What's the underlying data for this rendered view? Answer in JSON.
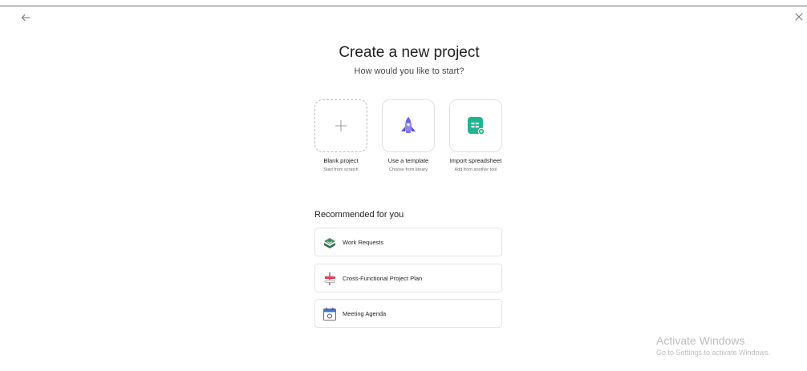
{
  "header": {
    "title": "Create a new project",
    "subtitle": "How would you like to start?"
  },
  "options": [
    {
      "label": "Blank project",
      "sub": "Start from scratch",
      "icon": "plus-icon"
    },
    {
      "label": "Use a template",
      "sub": "Choose from library",
      "icon": "rocket-icon"
    },
    {
      "label": "Import spreadsheet",
      "sub": "Add from another tool",
      "icon": "spreadsheet-icon"
    }
  ],
  "recommended": {
    "heading": "Recommended for you",
    "items": [
      {
        "label": "Work Requests",
        "icon": "inbox-tray-icon"
      },
      {
        "label": "Cross-Functional Project Plan",
        "icon": "signpost-icon"
      },
      {
        "label": "Meeting Agenda",
        "icon": "calendar-icon"
      }
    ]
  },
  "watermark": {
    "title": "Activate Windows",
    "subtitle": "Go to Settings to activate Windows."
  },
  "colors": {
    "accent_purple": "#7a6ff0",
    "accent_green": "#1fb58f",
    "line": "#6d6e6f"
  }
}
